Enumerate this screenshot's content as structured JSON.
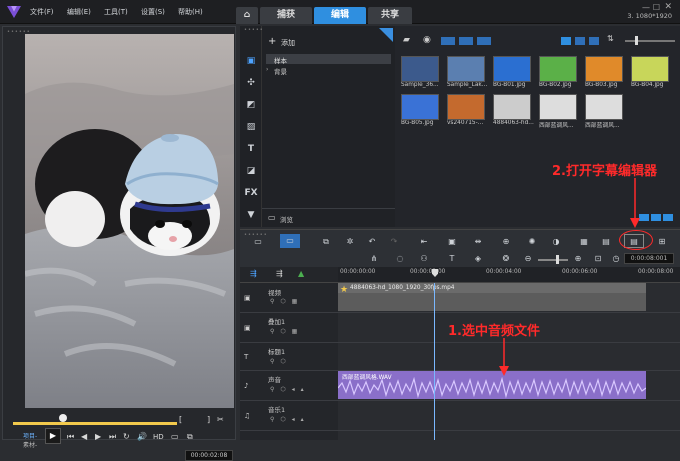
{
  "menu": {
    "file": "文件(F)",
    "edit": "编辑(E)",
    "tools": "工具(T)",
    "settings": "设置(S)",
    "help": "帮助(H)"
  },
  "tabs": {
    "home": "⌂",
    "capture": "捕获",
    "edit": "编辑",
    "share": "共享"
  },
  "resolution": "3. 1080*1920",
  "library": {
    "add_label": "添加",
    "folders": [
      "样本",
      "背景"
    ],
    "browse_label": "浏览",
    "items": [
      {
        "name": "Sample_36...",
        "color": "#3c5a8c"
      },
      {
        "name": "Sample_Lak...",
        "color": "#5b7fb0"
      },
      {
        "name": "BG-B01.jpg",
        "color": "#2b6fd1"
      },
      {
        "name": "BG-B02.jpg",
        "color": "#5bb048"
      },
      {
        "name": "BG-B03.jpg",
        "color": "#e08a2a"
      },
      {
        "name": "BG-B04.jpg",
        "color": "#c8d65a"
      },
      {
        "name": "BG-B05.jpg",
        "color": "#3a72d6"
      },
      {
        "name": "vs240715-...",
        "color": "#c46a2e"
      },
      {
        "name": "4884063-hd...",
        "color": "#cccccc"
      },
      {
        "name": "西部蓝调风...",
        "color": "#dddddd"
      },
      {
        "name": "西部蓝调风...",
        "color": "#dddddd"
      }
    ]
  },
  "preview": {
    "project_label": "项目-",
    "clip_label": "素材-",
    "hd": "HD",
    "timecode": "00:00:02:08"
  },
  "timeline": {
    "ruler": [
      "00:00:00:00",
      "00:00:02:00",
      "00:00:04:00",
      "00:00:06:00",
      "00:00:08:00"
    ],
    "timecode": "0:00:08:001",
    "tracks": [
      {
        "name": "视频"
      },
      {
        "name": "叠加1"
      },
      {
        "name": "标题1"
      },
      {
        "name": "声音"
      },
      {
        "name": "音乐1"
      }
    ],
    "video_clip": "4884063-hd_1080_1920_30fps.mp4",
    "audio_clip": "西部蓝调风格.WAV"
  },
  "annotations": {
    "open_subtitle": "2.打开字幕编辑器",
    "select_audio": "1.选中音频文件"
  },
  "colors": {
    "accent": "#2f8fe0",
    "annotation": "#ff2a2a",
    "audio_clip": "#8a6fc9",
    "scrubber": "#f2c94c"
  }
}
